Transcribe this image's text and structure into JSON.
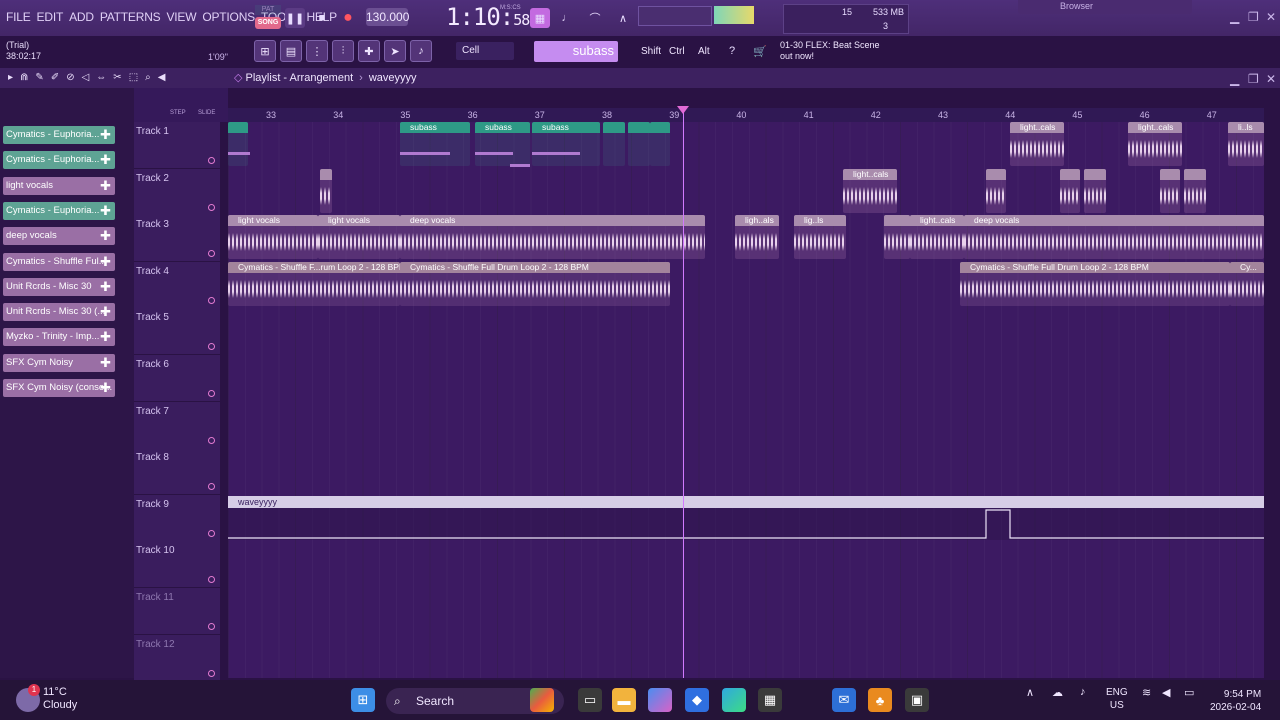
{
  "menu": [
    "FILE",
    "EDIT",
    "ADD",
    "PATTERNS",
    "VIEW",
    "OPTIONS",
    "TOOLS",
    "HELP"
  ],
  "transport": {
    "pat": "PAT",
    "song": "SONG",
    "tempo": "130.000",
    "time": "1:10",
    "time_small": "58",
    "msc": "M:S:CS"
  },
  "cpu": {
    "value": "15",
    "ram": "533 MB",
    "voices": "3"
  },
  "hint": {
    "line1": "(Trial)",
    "line2": "38:02:17"
  },
  "time_right": "1'09\"",
  "toolbar": {
    "snap": "Cell",
    "pattern": "subass",
    "shift": "Shift",
    "ctrl": "Ctrl",
    "alt": "Alt"
  },
  "news": {
    "line1": "01-30  FLEX: Beat Scene",
    "line2": "out now!"
  },
  "browser": "Browser",
  "playlist": {
    "title": "Playlist - Arrangement",
    "pattern": "waveyyyy",
    "step": "STEP",
    "slide": "SLIDE"
  },
  "channels": [
    {
      "label": "Cymatics - Euphoria...",
      "color": "#5ea394"
    },
    {
      "label": "Cymatics - Euphoria...",
      "color": "#5ea394"
    },
    {
      "label": "light vocals",
      "color": "#9a6fa5"
    },
    {
      "label": "Cymatics - Euphoria...",
      "color": "#5ea394"
    },
    {
      "label": "deep vocals",
      "color": "#9a6fa5"
    },
    {
      "label": "Cymatics - Shuffle Ful...",
      "color": "#9a6fa5"
    },
    {
      "label": "Unit Rcrds - Misc 30",
      "color": "#9a6fa5"
    },
    {
      "label": "Unit Rcrds - Misc 30 (...",
      "color": "#9a6fa5"
    },
    {
      "label": "Myzko - Trinity - Imp...",
      "color": "#9a6fa5"
    },
    {
      "label": "SFX Cym Noisy",
      "color": "#9a6fa5"
    },
    {
      "label": "SFX Cym Noisy (conso...",
      "color": "#9a6fa5"
    }
  ],
  "tracks": [
    "Track 1",
    "Track 2",
    "Track 3",
    "Track 4",
    "Track 5",
    "Track 6",
    "Track 7",
    "Track 8",
    "Track 9",
    "Track 10",
    "Track 11",
    "Track 12"
  ],
  "ruler": [
    "33",
    "34",
    "35",
    "36",
    "37",
    "38",
    "39",
    "40",
    "41",
    "42",
    "43",
    "44",
    "45",
    "46",
    "47"
  ],
  "clips": {
    "subass1": "subass",
    "subass2": "subass",
    "subass3": "subass",
    "lightcals1": "light..cals",
    "lightcals2": "light..cals",
    "lils": "li..ls",
    "lightcals3": "light..cals",
    "lv1": "light vocals",
    "lv2": "light vocals",
    "dv1": "deep vocals",
    "ligh1": "ligh..als",
    "lig2": "lig..ls",
    "lightcals4": "light..cals",
    "dv2": "deep vocals",
    "drum1": "Cymatics - Shuffle F...rum Loop 2 - 128 BPM",
    "drum2": "Cymatics - Shuffle Full Drum Loop 2 - 128 BPM",
    "drum3": "Cymatics - Shuffle Full Drum Loop 2 - 128 BPM",
    "drum4": "Cy...",
    "auto": "waveyyyy"
  },
  "taskbar": {
    "temp": "11°C",
    "cond": "Cloudy",
    "search": "Search",
    "lang1": "ENG",
    "lang2": "US",
    "time": "9:54 PM",
    "date": "2026-02-04",
    "badge": "1"
  }
}
